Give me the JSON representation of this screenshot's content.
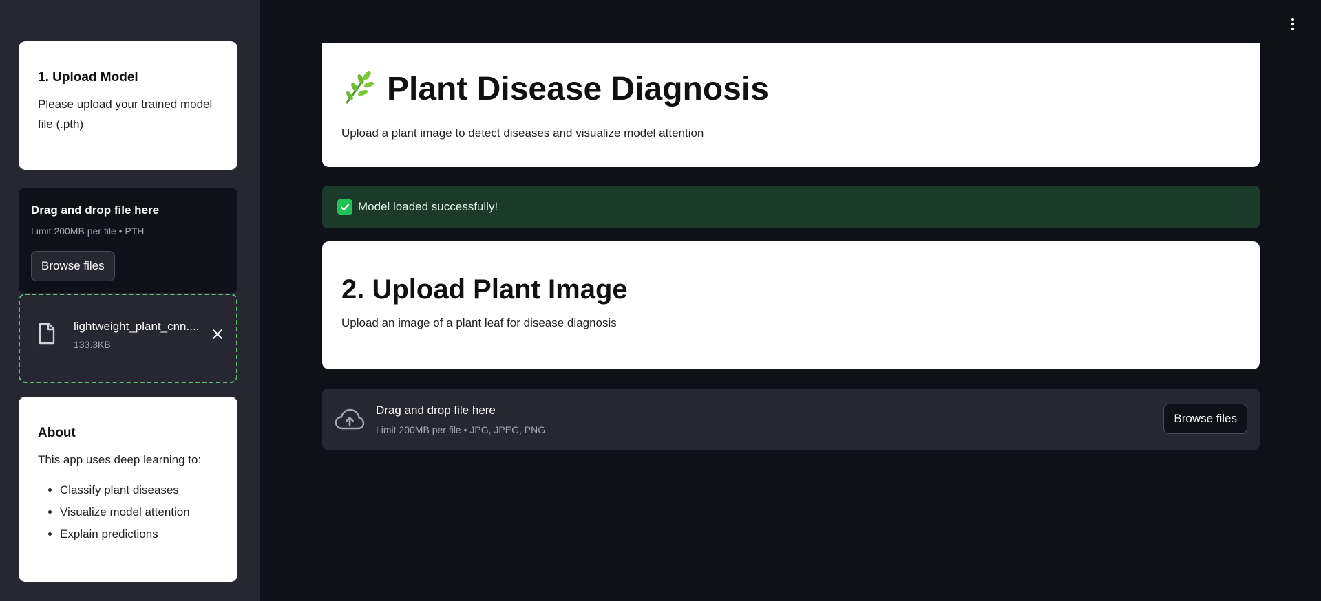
{
  "sidebar": {
    "upload_model": {
      "title": "1. Upload Model",
      "description": "Please upload your trained model file (.pth)"
    },
    "model_uploader": {
      "drag_text": "Drag and drop file here",
      "limit_text": "Limit 200MB per file • PTH",
      "browse_label": "Browse files"
    },
    "uploaded_file": {
      "name": "lightweight_plant_cnn....",
      "size": "133.3KB"
    },
    "about": {
      "title": "About",
      "intro": "This app uses deep learning to:",
      "items": [
        "Classify plant diseases",
        "Visualize model attention",
        "Explain predictions"
      ]
    }
  },
  "main": {
    "header": {
      "icon": "herb-icon",
      "title": "Plant Disease Diagnosis",
      "subtitle": "Upload a plant image to detect diseases and visualize model attention"
    },
    "status": {
      "message": "Model loaded successfully!"
    },
    "section2": {
      "title": "2. Upload Plant Image",
      "description": "Upload an image of a plant leaf for disease diagnosis"
    },
    "image_uploader": {
      "drag_text": "Drag and drop file here",
      "limit_text": "Limit 200MB per file • JPG, JPEG, PNG",
      "browse_label": "Browse files"
    }
  },
  "colors": {
    "background": "#0e1117",
    "sidebar": "#262730",
    "success_bg": "#1c3a2a",
    "success_check": "#21c354",
    "dashed_border": "#5fbf6e"
  }
}
